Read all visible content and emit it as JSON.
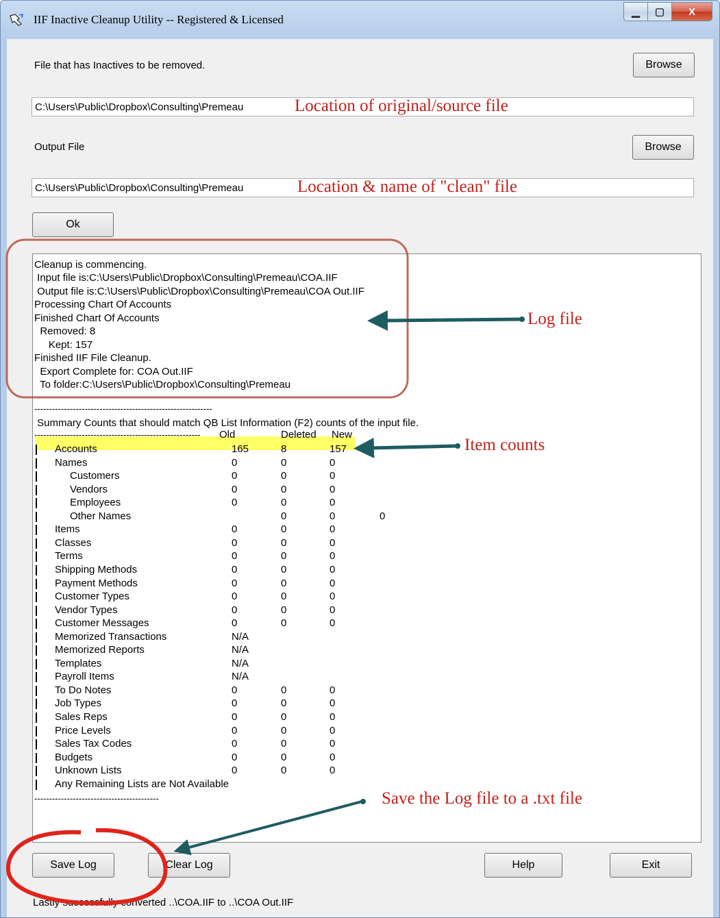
{
  "window": {
    "title": "IIF Inactive Cleanup Utility -- Registered & Licensed",
    "minimize_glyph": "▁",
    "maximize_glyph": "▢",
    "close_glyph": "X"
  },
  "input_section": {
    "label": "File that has Inactives to be removed.",
    "browse_label": "Browse",
    "value": "C:\\Users\\Public\\Dropbox\\Consulting\\Premeau"
  },
  "output_section": {
    "label": "Output File",
    "browse_label": "Browse",
    "value": "C:\\Users\\Public\\Dropbox\\Consulting\\Premeau"
  },
  "ok_label": "Ok",
  "log": {
    "header_lines": [
      "Cleanup is commencing.",
      " Input file is:C:\\Users\\Public\\Dropbox\\Consulting\\Premeau\\COA.IIF",
      " Output file is:C:\\Users\\Public\\Dropbox\\Consulting\\Premeau\\COA Out.IIF",
      "Processing Chart Of Accounts",
      "Finished Chart Of Accounts",
      "  Removed: 8",
      "     Kept: 157",
      "Finished IIF File Cleanup.",
      "  Export Complete for: COA Out.IIF",
      "  To folder:C:\\Users\\Public\\Dropbox\\Consulting\\Premeau"
    ],
    "separator_top": "------------------------------------------------------------",
    "summary_title": " Summary Counts that should match QB List Information (F2) counts of the input file.",
    "table_header_rule": "--------------------------------------------------------",
    "col_old": "Old",
    "col_deleted": "Deleted",
    "col_new": "New",
    "rows": [
      {
        "name": "Accounts",
        "indent": 0,
        "old": "165",
        "deleted": "8",
        "new": "157",
        "extra": ""
      },
      {
        "name": "Names",
        "indent": 0,
        "old": "0",
        "deleted": "0",
        "new": "0",
        "extra": ""
      },
      {
        "name": "Customers",
        "indent": 1,
        "old": "0",
        "deleted": "0",
        "new": "0",
        "extra": ""
      },
      {
        "name": "Vendors",
        "indent": 1,
        "old": "0",
        "deleted": "0",
        "new": "0",
        "extra": ""
      },
      {
        "name": "Employees",
        "indent": 1,
        "old": "0",
        "deleted": "0",
        "new": "0",
        "extra": ""
      },
      {
        "name": "Other Names",
        "indent": 1,
        "old": "",
        "deleted": "0",
        "new": "0",
        "extra": "0"
      },
      {
        "name": "Items",
        "indent": 0,
        "old": "0",
        "deleted": "0",
        "new": "0",
        "extra": ""
      },
      {
        "name": "Classes",
        "indent": 0,
        "old": "0",
        "deleted": "0",
        "new": "0",
        "extra": ""
      },
      {
        "name": "Terms",
        "indent": 0,
        "old": "0",
        "deleted": "0",
        "new": "0",
        "extra": ""
      },
      {
        "name": "Shipping Methods",
        "indent": 0,
        "old": "0",
        "deleted": "0",
        "new": "0",
        "extra": ""
      },
      {
        "name": "Payment Methods",
        "indent": 0,
        "old": "0",
        "deleted": "0",
        "new": "0",
        "extra": ""
      },
      {
        "name": "Customer Types",
        "indent": 0,
        "old": "0",
        "deleted": "0",
        "new": "0",
        "extra": ""
      },
      {
        "name": "Vendor Types",
        "indent": 0,
        "old": "0",
        "deleted": "0",
        "new": "0",
        "extra": ""
      },
      {
        "name": "Customer Messages",
        "indent": 0,
        "old": "0",
        "deleted": "0",
        "new": "0",
        "extra": ""
      },
      {
        "name": "Memorized Transactions",
        "indent": 0,
        "old": "N/A",
        "deleted": "",
        "new": "",
        "extra": ""
      },
      {
        "name": "Memorized Reports",
        "indent": 0,
        "old": "N/A",
        "deleted": "",
        "new": "",
        "extra": ""
      },
      {
        "name": "Templates",
        "indent": 0,
        "old": "N/A",
        "deleted": "",
        "new": "",
        "extra": ""
      },
      {
        "name": "Payroll Items",
        "indent": 0,
        "old": "N/A",
        "deleted": "",
        "new": "",
        "extra": ""
      },
      {
        "name": "To Do Notes",
        "indent": 0,
        "old": "0",
        "deleted": "0",
        "new": "0",
        "extra": ""
      },
      {
        "name": "Job Types",
        "indent": 0,
        "old": "0",
        "deleted": "0",
        "new": "0",
        "extra": ""
      },
      {
        "name": "Sales Reps",
        "indent": 0,
        "old": "0",
        "deleted": "0",
        "new": "0",
        "extra": ""
      },
      {
        "name": "Price Levels",
        "indent": 0,
        "old": "0",
        "deleted": "0",
        "new": "0",
        "extra": ""
      },
      {
        "name": "Sales Tax Codes",
        "indent": 0,
        "old": "0",
        "deleted": "0",
        "new": "0",
        "extra": ""
      },
      {
        "name": "Budgets",
        "indent": 0,
        "old": "0",
        "deleted": "0",
        "new": "0",
        "extra": ""
      },
      {
        "name": "Unknown Lists",
        "indent": 0,
        "old": "0",
        "deleted": "0",
        "new": "0",
        "extra": ""
      },
      {
        "name": "Any Remaining Lists are Not Available",
        "indent": 0,
        "old": "",
        "deleted": "",
        "new": "",
        "extra": ""
      }
    ],
    "separator_bottom": "------------------------------------------"
  },
  "buttons": {
    "save_log": "Save Log",
    "clear_log": "Clear Log",
    "help": "Help",
    "exit": "Exit"
  },
  "status": "Lastly successfully converted ..\\COA.IIF to ..\\COA Out.IIF",
  "annotations": {
    "source": "Location of original/source file",
    "clean": "Location & name of \"clean\" file",
    "log": "Log file",
    "counts": "Item counts",
    "save": "Save the Log file to a .txt file"
  },
  "colors": {
    "annotation_red": "#c0221b",
    "arrow_teal": "#1f5c61",
    "highlight_yellow": "#ffff66",
    "frame_blue": "#b6cde9"
  }
}
